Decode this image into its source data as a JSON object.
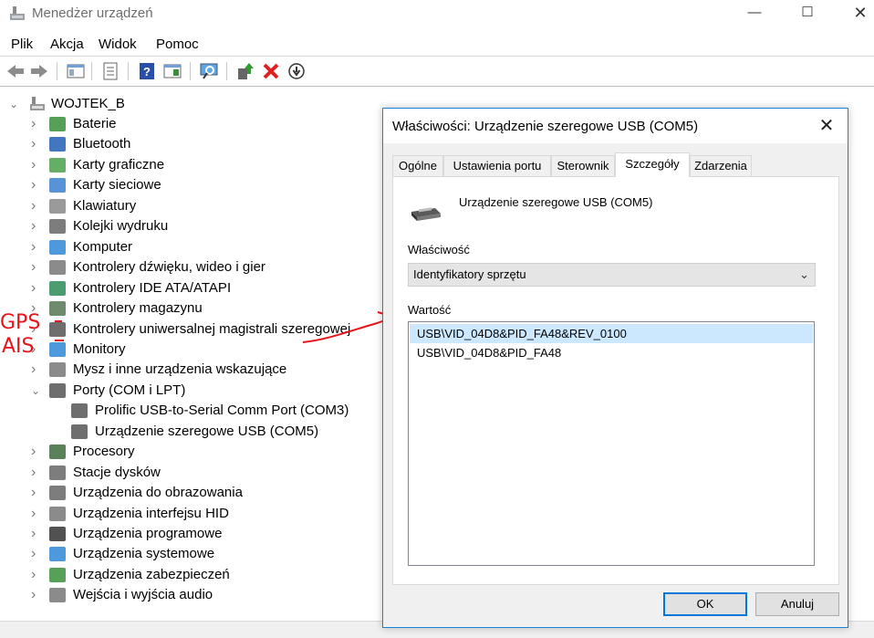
{
  "window": {
    "title": "Menedżer urządzeń"
  },
  "menu": {
    "items": [
      "Plik",
      "Akcja",
      "Widok",
      "Pomoc"
    ]
  },
  "tree": {
    "root": "WOJTEK_B",
    "categories": [
      {
        "label": "Baterie",
        "icon": "battery-icon"
      },
      {
        "label": "Bluetooth",
        "icon": "bluetooth-icon"
      },
      {
        "label": "Karty graficzne",
        "icon": "display-adapter-icon"
      },
      {
        "label": "Karty sieciowe",
        "icon": "network-adapter-icon"
      },
      {
        "label": "Klawiatury",
        "icon": "keyboard-icon"
      },
      {
        "label": "Kolejki wydruku",
        "icon": "printer-icon"
      },
      {
        "label": "Komputer",
        "icon": "computer-icon"
      },
      {
        "label": "Kontrolery dźwięku, wideo i gier",
        "icon": "speaker-icon"
      },
      {
        "label": "Kontrolery IDE ATA/ATAPI",
        "icon": "ide-controller-icon"
      },
      {
        "label": "Kontrolery magazynu",
        "icon": "storage-controller-icon"
      },
      {
        "label": "Kontrolery uniwersalnej magistrali szeregowej",
        "icon": "usb-icon"
      },
      {
        "label": "Monitory",
        "icon": "monitor-icon"
      },
      {
        "label": "Mysz i inne urządzenia wskazujące",
        "icon": "mouse-icon"
      },
      {
        "label": "Porty (COM i LPT)",
        "icon": "port-icon",
        "expanded": true
      },
      {
        "label": "Prolific USB-to-Serial Comm Port (COM3)",
        "icon": "port-icon",
        "child": true
      },
      {
        "label": "Urządzenie szeregowe USB (COM5)",
        "icon": "port-icon",
        "child": true
      },
      {
        "label": "Procesory",
        "icon": "processor-icon"
      },
      {
        "label": "Stacje dysków",
        "icon": "disk-drive-icon"
      },
      {
        "label": "Urządzenia do obrazowania",
        "icon": "camera-icon"
      },
      {
        "label": "Urządzenia interfejsu HID",
        "icon": "hid-icon"
      },
      {
        "label": "Urządzenia programowe",
        "icon": "software-device-icon"
      },
      {
        "label": "Urządzenia systemowe",
        "icon": "system-device-icon"
      },
      {
        "label": "Urządzenia zabezpieczeń",
        "icon": "security-device-icon"
      },
      {
        "label": "Wejścia i wyjścia audio",
        "icon": "audio-io-icon"
      }
    ]
  },
  "annotations": {
    "gps": "GPS",
    "ais": "AIS",
    "color": "#e8141b"
  },
  "dialog": {
    "title": "Właściwości: Urządzenie szeregowe USB (COM5)",
    "tabs": [
      "Ogólne",
      "Ustawienia portu",
      "Sterownik",
      "Szczegóły",
      "Zdarzenia"
    ],
    "active_tab": "Szczegóły",
    "device_name": "Urządzenie szeregowe USB (COM5)",
    "property_label": "Właściwość",
    "property_value": "Identyfikatory sprzętu",
    "value_label": "Wartość",
    "values": [
      "USB\\VID_04D8&PID_FA48&REV_0100",
      "USB\\VID_04D8&PID_FA48"
    ],
    "ok_label": "OK",
    "cancel_label": "Anuluj"
  }
}
